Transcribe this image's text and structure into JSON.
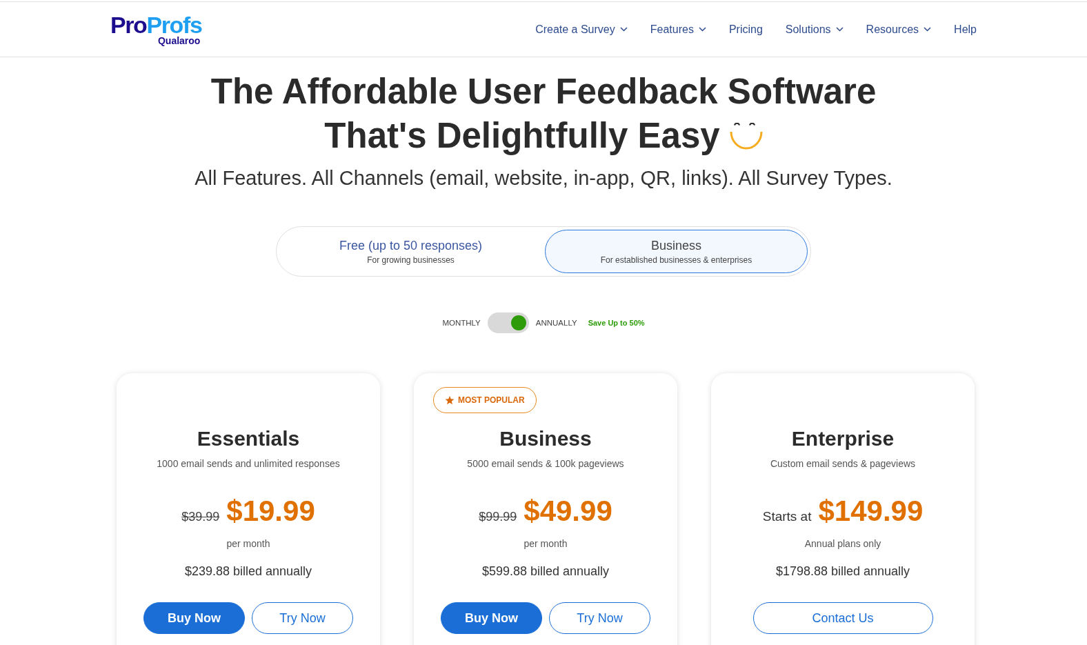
{
  "header": {
    "logo": {
      "wordmark": [
        "Pro",
        "Profs"
      ],
      "product": "Qualaroo"
    },
    "nav": [
      {
        "label": "Create a Survey",
        "dropdown": true
      },
      {
        "label": "Features",
        "dropdown": true
      },
      {
        "label": "Pricing",
        "dropdown": false
      },
      {
        "label": "Solutions",
        "dropdown": true
      },
      {
        "label": "Resources",
        "dropdown": true
      },
      {
        "label": "Help",
        "dropdown": false
      }
    ]
  },
  "hero": {
    "title_lines": [
      "The Affordable User Feedback Software",
      "That's Delightfully Easy"
    ],
    "subtitle": "All Features. All Channels (email, website, in-app, QR, links). All Survey Types."
  },
  "plan_tabs": [
    {
      "title": "Free (up to 50 responses)",
      "subtitle": "For growing businesses",
      "selected": false
    },
    {
      "title": "Business",
      "subtitle": "For established businesses & enterprises",
      "selected": true
    }
  ],
  "billing": {
    "left_label": "MONTHLY",
    "right_label": "ANNUALLY",
    "on": true,
    "save_note": "Save Up to 50%"
  },
  "plans": [
    {
      "name": "Essentials",
      "description": "1000 email sends and unlimited responses",
      "old_price": "$39.99",
      "price": "$19.99",
      "note": "per month",
      "billed": "$239.88 billed annually",
      "buttons": [
        {
          "label": "Buy Now",
          "kind": "filled"
        },
        {
          "label": "Try Now",
          "kind": "outline"
        }
      ]
    },
    {
      "badge": "MOST POPULAR",
      "name": "Business",
      "description": "5000 email sends & 100k pageviews",
      "old_price": "$99.99",
      "price": "$49.99",
      "note": "per month",
      "billed": "$599.88 billed annually",
      "buttons": [
        {
          "label": "Buy Now",
          "kind": "filled"
        },
        {
          "label": "Try Now",
          "kind": "outline"
        }
      ]
    },
    {
      "name": "Enterprise",
      "description": "Custom email sends & pageviews",
      "price_prefix": "Starts at",
      "price": "$149.99",
      "note": "Annual plans only",
      "billed": "$1798.88 billed annually",
      "buttons": [
        {
          "label": "Contact Us",
          "kind": "outline"
        }
      ]
    }
  ]
}
